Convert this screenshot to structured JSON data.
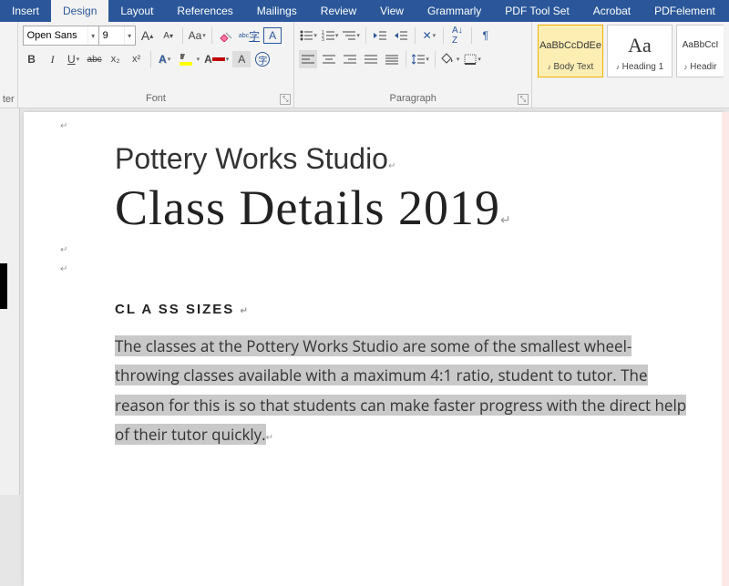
{
  "tabs": [
    "Insert",
    "Design",
    "Layout",
    "References",
    "Mailings",
    "Review",
    "View",
    "Grammarly",
    "PDF Tool Set",
    "Acrobat",
    "PDFelement"
  ],
  "active_tab": "Design",
  "left_cut": "ter",
  "font": {
    "name": "Open Sans",
    "size": "9",
    "grow_label": "A",
    "shrink_label": "A",
    "case_label": "Aa",
    "bold": "B",
    "italic": "I",
    "underline": "U",
    "strike": "abc",
    "sub": "x₂",
    "sup": "x²",
    "group_label": "Font"
  },
  "para": {
    "group_label": "Paragraph"
  },
  "styles": {
    "body_prev": "AaBbCcDdEe",
    "body_label": "Body Text",
    "h1_prev": "Aa",
    "h1_label": "Heading 1",
    "h2_prev": "AaBbCcI",
    "h2_label": "Headir"
  },
  "doc": {
    "title2": "Pottery Works Studio",
    "title1": "Class Details 2019",
    "h3": "CL A SS SIZES",
    "body": "The classes at the Pottery Works Studio are some of the smallest wheel- throwing classes available with a maximum 4:1 ratio, student to tutor. The reason for this is so that students can make faster progress with the direct help of their tutor quickly."
  }
}
